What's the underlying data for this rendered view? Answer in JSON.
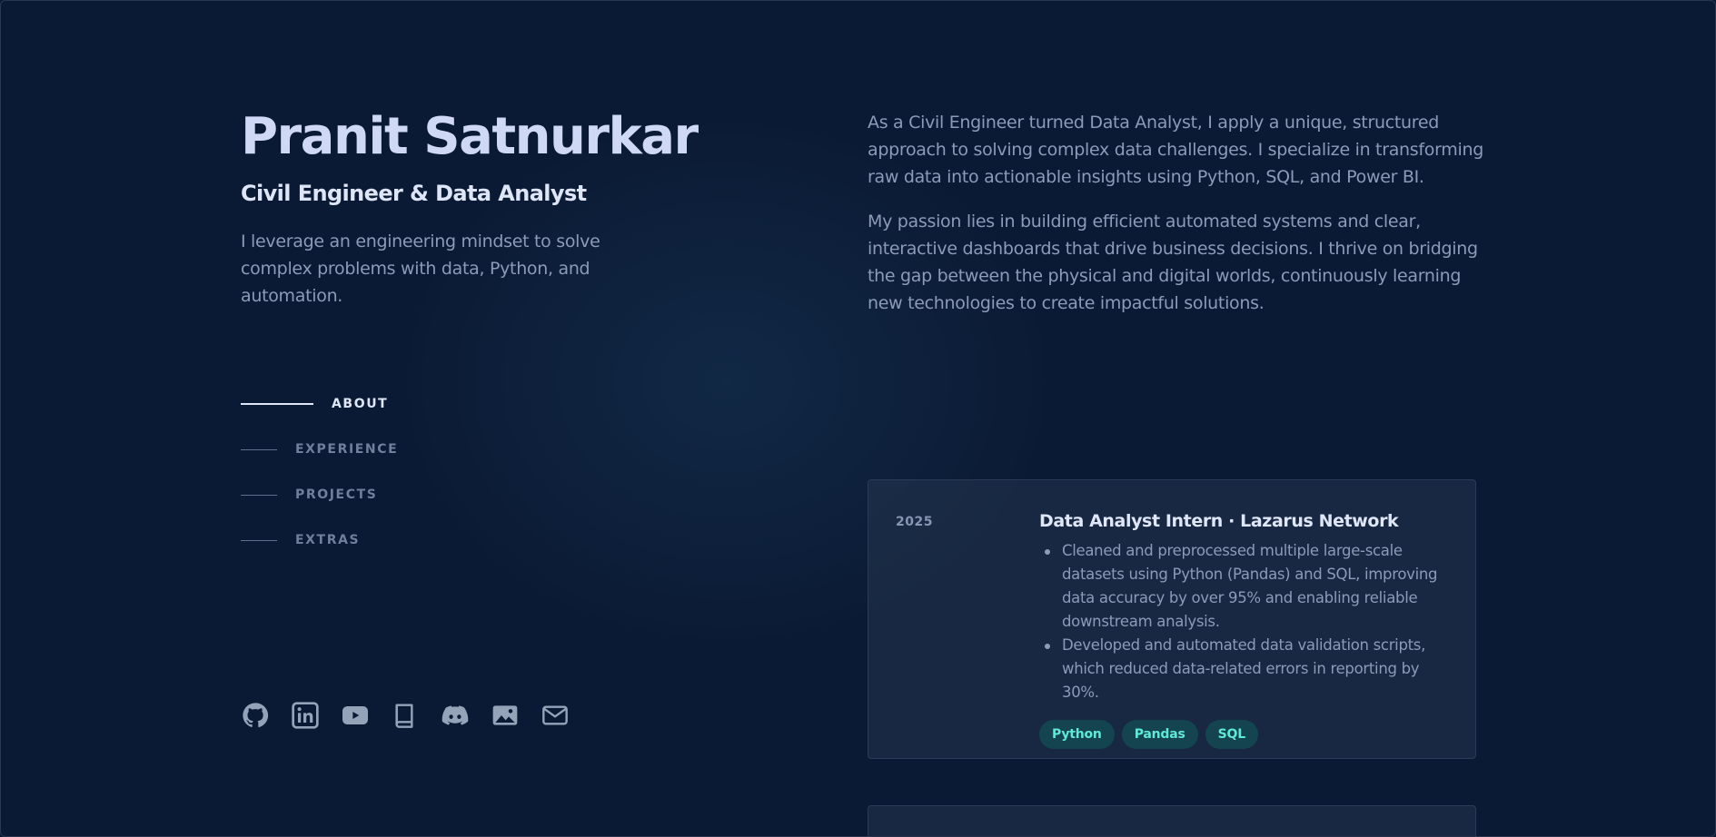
{
  "profile": {
    "name": "Pranit Satnurkar",
    "role": "Civil Engineer & Data Analyst",
    "tagline": "I leverage an engineering mindset to solve complex problems with data, Python, and automation."
  },
  "nav": {
    "items": [
      {
        "label": "ABOUT",
        "active": true
      },
      {
        "label": "EXPERIENCE",
        "active": false
      },
      {
        "label": "PROJECTS",
        "active": false
      },
      {
        "label": "EXTRAS",
        "active": false
      }
    ]
  },
  "socials": [
    {
      "icon": "github-icon"
    },
    {
      "icon": "linkedin-icon"
    },
    {
      "icon": "youtube-icon"
    },
    {
      "icon": "book-icon"
    },
    {
      "icon": "discord-icon"
    },
    {
      "icon": "image-icon"
    },
    {
      "icon": "mail-icon"
    }
  ],
  "about": {
    "paragraphs": [
      "As a Civil Engineer turned Data Analyst, I apply a unique, structured approach to solving complex data challenges. I specialize in transforming raw data into actionable insights using Python, SQL, and Power BI.",
      "My passion lies in building efficient automated systems and clear, interactive dashboards that drive business decisions. I thrive on bridging the gap between the physical and digital worlds, continuously learning new technologies to create impactful solutions."
    ]
  },
  "experience": [
    {
      "period": "2025",
      "title": "Data Analyst Intern · Lazarus Network",
      "bullets": [
        "Cleaned and preprocessed multiple large-scale datasets using Python (Pandas) and SQL, improving data accuracy by over 95% and enabling reliable downstream analysis.",
        "Developed and automated data validation scripts, which reduced data-related errors in reporting by 30%."
      ],
      "tags": [
        "Python",
        "Pandas",
        "SQL"
      ]
    }
  ],
  "colors": {
    "background": "#0b1a34",
    "heading": "#cfd9f6",
    "body_text": "#8b9bb8",
    "tag_bg": "#14444f",
    "tag_text": "#5eead4"
  }
}
